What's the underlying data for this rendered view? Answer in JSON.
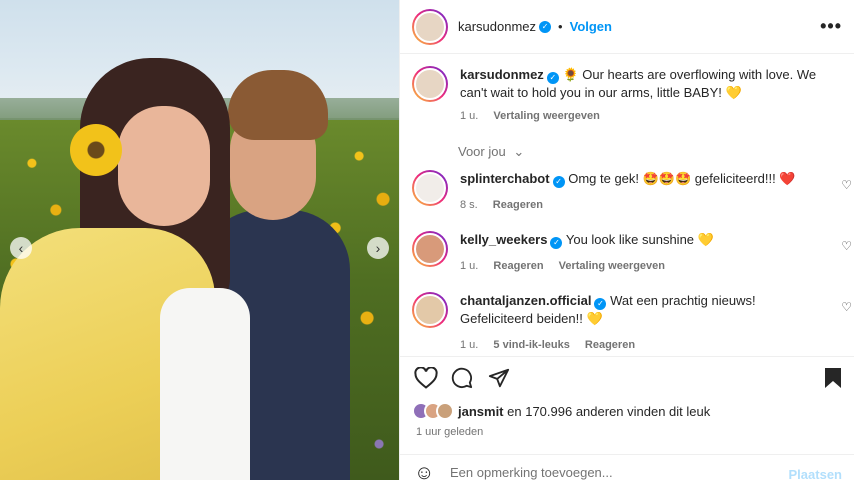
{
  "post": {
    "username": "karsudonmez",
    "follow_label": "Volgen",
    "separator": "•",
    "more_label": "•••",
    "caption": "🌻 Our hearts are overflowing with love. We can't wait to hold you in our arms, little BABY! 💛",
    "caption_time": "1 u.",
    "caption_translate": "Vertaling weergeven"
  },
  "sort_label": "Voor jou",
  "comments": [
    {
      "username": "splinterchabot",
      "text": "Omg te gek! 🤩🤩🤩 gefeliciteerd!!! ❤️",
      "time": "8 s.",
      "actions": [
        "Reageren"
      ]
    },
    {
      "username": "kelly_weekers",
      "text": "You look like sunshine 💛",
      "time": "1 u.",
      "actions": [
        "Reageren",
        "Vertaling weergeven"
      ]
    },
    {
      "username": "chantaljanzen.official",
      "text": "Wat een prachtig nieuws! Gefeliciteerd beiden!! 💛",
      "time": "1 u.",
      "actions": [
        "5 vind-ik-leuks",
        "Reageren"
      ]
    }
  ],
  "likes": {
    "user": "jansmit",
    "text": "en 170.996 anderen vinden dit leuk"
  },
  "time_ago": "1 uur geleden",
  "comment_box": {
    "placeholder": "Een opmerking toevoegen...",
    "post_label": "Plaatsen"
  },
  "icons": {
    "prev": "chevron-left-icon",
    "next": "chevron-right-icon",
    "like": "heart-icon",
    "comment": "comment-icon",
    "share": "send-icon",
    "save": "bookmark-icon",
    "emoji": "smiley-icon"
  },
  "colors": {
    "accent": "#0095f6",
    "muted": "#737373",
    "post_disabled": "#b2dffc"
  }
}
